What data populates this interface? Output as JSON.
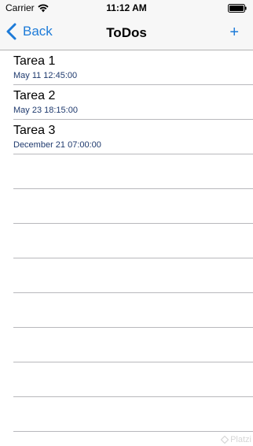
{
  "status_bar": {
    "carrier": "Carrier",
    "time": "11:12 AM"
  },
  "nav_bar": {
    "back_label": "Back",
    "title": "ToDos",
    "add_label": "+",
    "accent_color": "#1d7bd8"
  },
  "todos": [
    {
      "title": "Tarea 1",
      "date": "May 11 12:45:00"
    },
    {
      "title": "Tarea 2",
      "date": "May 23 18:15:00"
    },
    {
      "title": "Tarea 3",
      "date": "December 21 07:00:00"
    }
  ],
  "watermark": "Platzi"
}
